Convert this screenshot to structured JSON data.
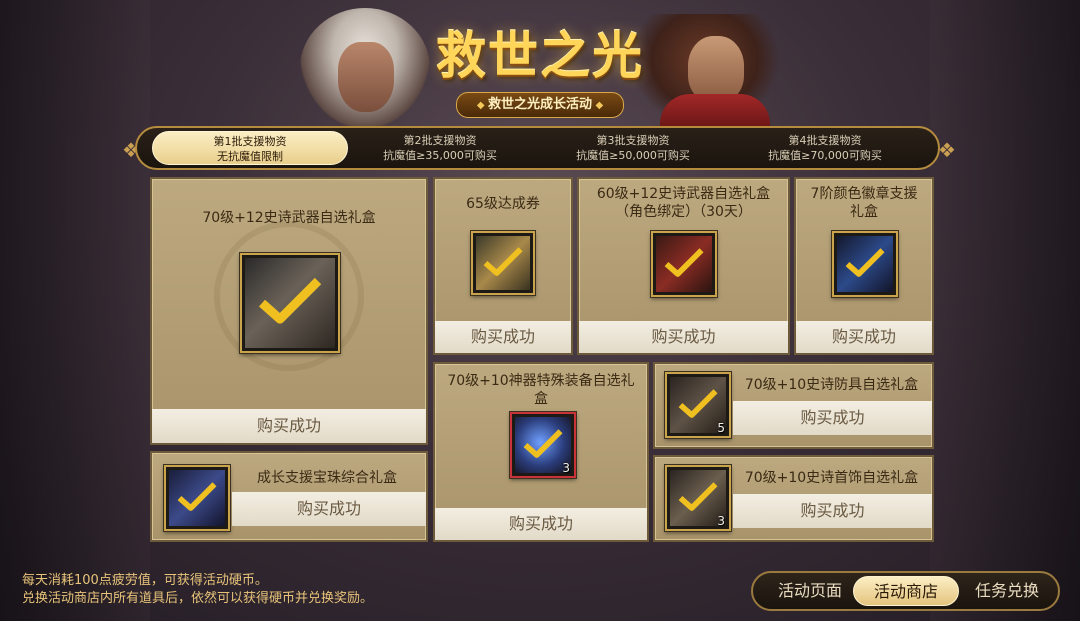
{
  "header": {
    "title": "救世之光",
    "subtitle": "救世之光成长活动"
  },
  "tabs": [
    {
      "line1": "第1批支援物资",
      "line2": "无抗魔值限制",
      "active": true
    },
    {
      "line1": "第2批支援物资",
      "line2": "抗魔值≥35,000可购买",
      "active": false
    },
    {
      "line1": "第3批支援物资",
      "line2": "抗魔值≥50,000可购买",
      "active": false
    },
    {
      "line1": "第4批支援物资",
      "line2": "抗魔值≥70,000可购买",
      "active": false
    }
  ],
  "items": {
    "epic_weapon_box": {
      "title": "70级+12史诗武器自选礼盒",
      "status": "购买成功",
      "icon": "weapon-box-icon"
    },
    "level65_ticket": {
      "title": "65级达成券",
      "status": "购买成功",
      "icon": "ticket-icon"
    },
    "bound_weapon_box": {
      "title": "60级+12史诗武器自选礼盒（角色绑定）（30天）",
      "status": "购买成功",
      "icon": "weapon-box-icon"
    },
    "emblem_box": {
      "title": "7阶颜色徽章支援礼盒",
      "status": "购买成功",
      "icon": "emblem-box-icon"
    },
    "artifact_box": {
      "title": "70级+10神器特殊装备自选礼盒",
      "status": "购买成功",
      "icon": "artifact-orb-icon",
      "count": "3"
    },
    "armor_box": {
      "title": "70级+10史诗防具自选礼盒",
      "status": "购买成功",
      "icon": "armor-box-icon",
      "count": "5"
    },
    "orb_box": {
      "title": "成长支援宝珠综合礼盒",
      "status": "购买成功",
      "icon": "orb-box-icon"
    },
    "accessory_box": {
      "title": "70级+10史诗首饰自选礼盒",
      "status": "购买成功",
      "icon": "accessory-box-icon",
      "count": "3"
    }
  },
  "notes": {
    "line1": "每天消耗100点疲劳值，可获得活动硬币。",
    "line2": "兑换活动商店内所有道具后，依然可以获得硬币并兑换奖励。"
  },
  "nav": {
    "page": "活动页面",
    "shop": "活动商店",
    "quest": "任务兑换",
    "active": "shop"
  },
  "colors": {
    "accent_gold": "#d8a84a",
    "check_gold": "#f0c020"
  }
}
